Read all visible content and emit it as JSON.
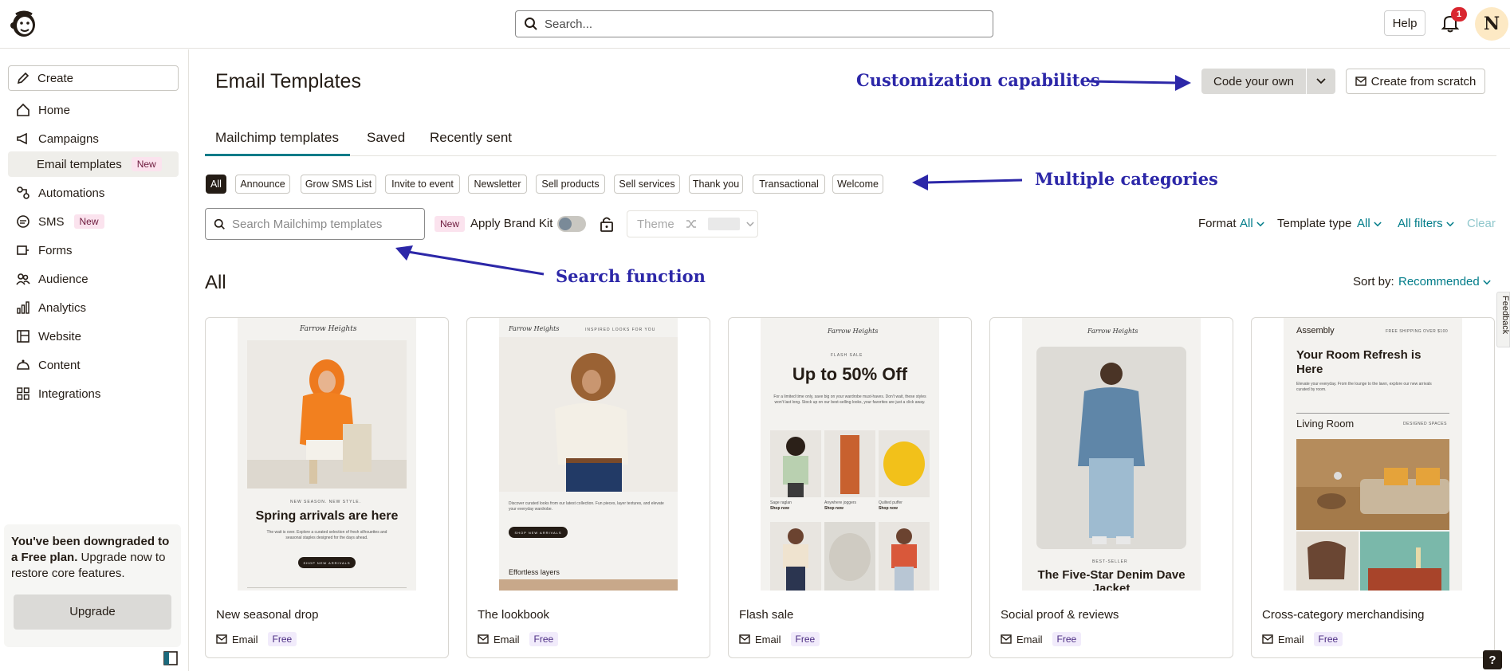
{
  "topbar": {
    "search_placeholder": "Search...",
    "help_label": "Help",
    "notification_count": "1",
    "avatar_initial": "N"
  },
  "sidebar": {
    "create_label": "Create",
    "items": [
      {
        "label": "Home"
      },
      {
        "label": "Campaigns"
      },
      {
        "label": "Email templates",
        "badge": "New"
      },
      {
        "label": "Automations"
      },
      {
        "label": "SMS",
        "badge": "New"
      },
      {
        "label": "Forms"
      },
      {
        "label": "Audience"
      },
      {
        "label": "Analytics"
      },
      {
        "label": "Website"
      },
      {
        "label": "Content"
      },
      {
        "label": "Integrations"
      }
    ],
    "downgrade": {
      "bold": "You've been downgraded to a Free plan.",
      "text": " Upgrade now to restore core features.",
      "upgrade_label": "Upgrade"
    }
  },
  "main": {
    "title": "Email Templates",
    "code_own_label": "Code your own",
    "create_scratch_label": "Create from scratch",
    "tabs": [
      {
        "label": "Mailchimp templates",
        "active": true
      },
      {
        "label": "Saved"
      },
      {
        "label": "Recently sent"
      }
    ],
    "categories": [
      "All",
      "Announce",
      "Grow SMS List",
      "Invite to event",
      "Newsletter",
      "Sell products",
      "Sell services",
      "Thank you",
      "Transactional",
      "Welcome"
    ],
    "search_placeholder": "Search Mailchimp templates",
    "new_badge": "New",
    "brand_kit_label": "Apply Brand Kit",
    "theme_label": "Theme",
    "filters": {
      "format_label": "Format",
      "format_value": "All",
      "type_label": "Template type",
      "type_value": "All",
      "all_filters": "All filters",
      "clear": "Clear"
    },
    "section_title": "All",
    "sort_label": "Sort by:",
    "sort_value": "Recommended",
    "feedback": "Feedback"
  },
  "annotations": {
    "customization": "Customization capabilites",
    "categories": "Multiple categories",
    "search": "Search function"
  },
  "cards": [
    {
      "name": "New seasonal drop",
      "format": "Email",
      "price": "Free",
      "brand": "Farrow Heights",
      "kicker": "NEW SEASON. NEW STYLE.",
      "headline": "Spring arrivals are here",
      "body": "The wait is over. Explore a curated selection of fresh silhouettes and seasonal staples designed for the days ahead.",
      "cta": "SHOP NEW ARRIVALS"
    },
    {
      "name": "The lookbook",
      "format": "Email",
      "price": "Free",
      "brand": "Farrow Heights",
      "kicker": "INSPIRED LOOKS FOR YOU",
      "body": "Discover curated looks from our latest collection. Fun pieces, layer textures, and elevate your everyday wardrobe.",
      "cta": "SHOP NEW ARRIVALS",
      "subhead": "Effortless layers"
    },
    {
      "name": "Flash sale",
      "format": "Email",
      "price": "Free",
      "brand": "Farrow Heights",
      "kicker": "FLASH SALE",
      "headline": "Up to 50% Off",
      "body": "For a limited time only, save big on your wardrobe must-haves. Don't wait, these styles won't last long. Stock up on our best-selling looks, your favorites are just a click away.",
      "products": [
        "Sage raglan",
        "Anywhere joggers",
        "Quilted puffer"
      ],
      "shop": "Shop now"
    },
    {
      "name": "Social proof & reviews",
      "format": "Email",
      "price": "Free",
      "brand": "Farrow Heights",
      "kicker": "BEST-SELLER",
      "headline": "The Five-Star Denim Dave Jacket"
    },
    {
      "name": "Cross-category merchandising",
      "format": "Email",
      "price": "Free",
      "brand": "Assembly",
      "kicker": "FREE SHIPPING OVER $100",
      "headline": "Your Room Refresh is Here",
      "body": "Elevate your everyday. From the lounge to the lawn, explore our new arrivals curated by room.",
      "subhead": "Living Room",
      "subkicker": "DESIGNED SPACES"
    }
  ]
}
